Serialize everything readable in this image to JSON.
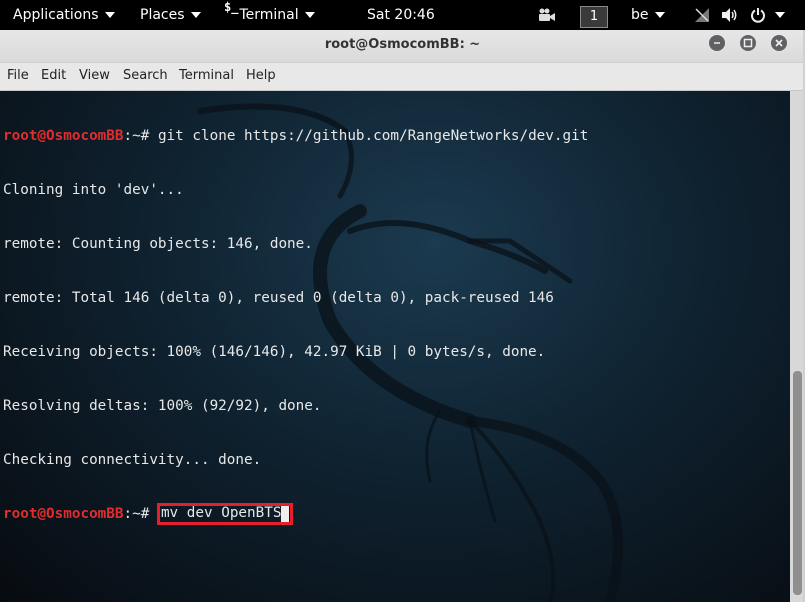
{
  "topbar": {
    "applications": "Applications",
    "places": "Places",
    "terminal_icon": "$_",
    "terminal": "Terminal",
    "clock": "Sat 20:46",
    "workspace": "1",
    "keyboard": "be"
  },
  "window": {
    "title": "root@OsmocomBB: ~"
  },
  "menu": [
    "File",
    "Edit",
    "View",
    "Search",
    "Terminal",
    "Help"
  ],
  "terminal": {
    "prompt_user": "root@OsmocomBB",
    "prompt_sep": ":~# ",
    "line0_cmd": "git clone https://github.com/RangeNetworks/dev.git",
    "line1": "Cloning into 'dev'...",
    "line2": "remote: Counting objects: 146, done.",
    "line3": "remote: Total 146 (delta 0), reused 0 (delta 0), pack-reused 146",
    "line4": "Receiving objects: 100% (146/146), 42.97 KiB | 0 bytes/s, done.",
    "line5": "Resolving deltas: 100% (92/92), done.",
    "line6": "Checking connectivity... done.",
    "line7_cmd": "mv dev OpenBTS"
  },
  "colors": {
    "prompt": "#e02d2d",
    "highlight_box": "#e5202c"
  }
}
